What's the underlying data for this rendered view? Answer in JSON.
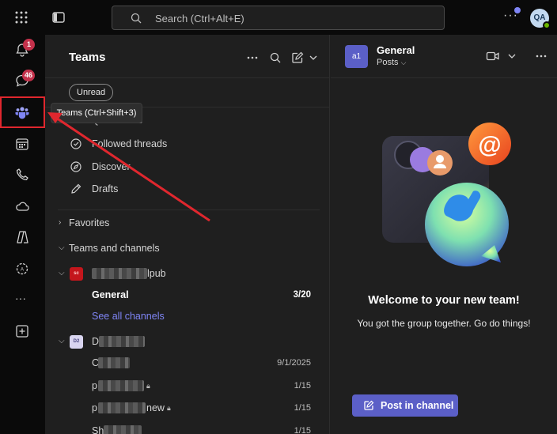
{
  "topbar": {
    "search_placeholder": "Search (Ctrl+Alt+E)",
    "more": "···",
    "avatar_initials": "QA"
  },
  "rail": {
    "activity_badge": "1",
    "chat_badge": "46",
    "more": "···"
  },
  "tooltip": "Teams (Ctrl+Shift+3)",
  "teams_pane": {
    "title": "Teams",
    "filter_chip": "Unread",
    "quick_views_label": "Quick views",
    "items": [
      {
        "label": "Followed threads"
      },
      {
        "label": "Discover"
      },
      {
        "label": "Drafts"
      }
    ],
    "favorites_label": "Favorites",
    "teams_channels_label": "Teams and channels",
    "team1": {
      "avatar": "sc",
      "name_suffix": "lpub",
      "channel": "General",
      "count": "3/20",
      "see_all": "See all channels"
    },
    "team2": {
      "avatar": "D2",
      "name_prefix": "D"
    },
    "channels": [
      {
        "prefix": "C",
        "suffix": "",
        "date": "9/1/2025"
      },
      {
        "prefix": "p",
        "suffix": "",
        "date": "1/15"
      },
      {
        "prefix": "p",
        "suffix": "new",
        "date": "1/15"
      },
      {
        "prefix": "Sh",
        "suffix": "",
        "date": "1/15"
      }
    ]
  },
  "channel_pane": {
    "avatar": "a1",
    "title": "General",
    "subtitle": "Posts",
    "welcome": "Welcome to your new team!",
    "welcome_sub": "You got the group together. Go do things!",
    "post_button": "Post in channel"
  },
  "colors": {
    "accent": "#5b5fc7",
    "annotation_red": "#e0272e",
    "badge_red": "#c4314b"
  }
}
